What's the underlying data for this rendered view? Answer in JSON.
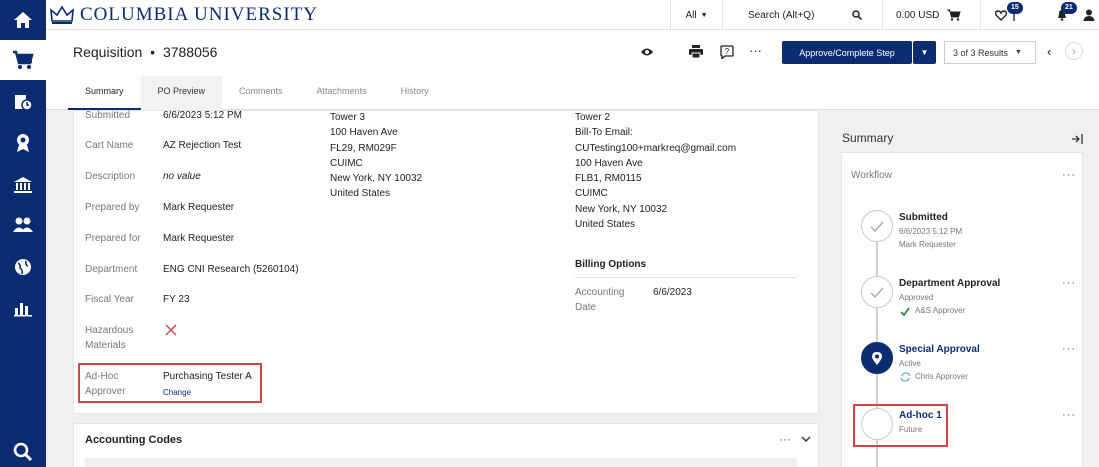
{
  "topbar": {
    "logo_text": "COLUMBIA UNIVERSITY",
    "all_label": "All",
    "search_label": "Search (Alt+Q)",
    "cart_amount": "0.00 USD",
    "flag_badge": "15",
    "bell_badge": "21"
  },
  "header": {
    "title": "Requisition",
    "separator": "•",
    "number": "3788056",
    "more": "···",
    "approve_label": "Approve/Complete Step",
    "results_label": "3 of 3 Results"
  },
  "tabs": [
    "Summary",
    "PO Preview",
    "Comments",
    "Attachments",
    "History"
  ],
  "details": [
    {
      "label": "Submitted",
      "value": "6/6/2023 5:12 PM"
    },
    {
      "label": "Cart Name",
      "value": "AZ Rejection Test"
    },
    {
      "label": "Description",
      "value": "no value"
    },
    {
      "label": "Prepared by",
      "value": "Mark Requester"
    },
    {
      "label": "Prepared for",
      "value": "Mark Requester"
    },
    {
      "label": "Department",
      "value": "ENG CNI Research (5260104)"
    },
    {
      "label": "Fiscal Year",
      "value": "FY 23"
    },
    {
      "label": "Hazardous",
      "label2": "Materials"
    },
    {
      "label": "Ad-Hoc",
      "label2": "Approver",
      "value": "Purchasing Tester A",
      "link": "Change"
    }
  ],
  "ship_address": [
    "Tower 3",
    "100 Haven Ave",
    "FL29, RM029F",
    "CUIMC",
    "New York, NY 10032",
    "United States"
  ],
  "bill_address": [
    "Tower 2",
    "Bill-To Email:",
    "CUTesting100+markreq@gmail.com",
    "100 Haven Ave",
    "FLB1, RM0115",
    "CUIMC",
    "New York, NY 10032",
    "United States"
  ],
  "billing": {
    "heading": "Billing Options",
    "label1": "Accounting",
    "label2": "Date",
    "value": "6/6/2023"
  },
  "accounting": {
    "title": "Accounting Codes",
    "more": "···"
  },
  "summary_panel": {
    "title": "Summary",
    "workflow_label": "Workflow",
    "more": "···",
    "steps": [
      {
        "name": "Submitted",
        "line1": "6/6/2023 5:12 PM",
        "line2": "Mark Requester"
      },
      {
        "name": "Department Approval",
        "line1": "Approved",
        "line2": "A&S Approver"
      },
      {
        "name": "Special Approval",
        "line1": "Active",
        "line2": "Chris Approver"
      },
      {
        "name": "Ad-hoc 1",
        "line1": "Future"
      }
    ]
  },
  "colors": {
    "brand": "#0c2c72",
    "highlight": "#d64545",
    "check": "#2e8b3a"
  }
}
